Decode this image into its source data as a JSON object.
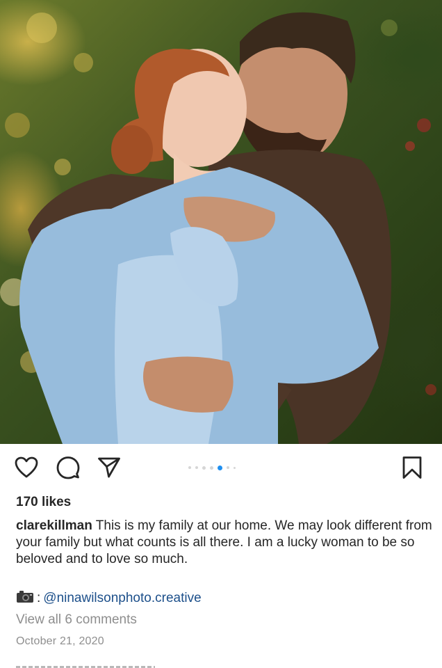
{
  "post": {
    "photo_alt": "Couple embracing outdoors",
    "likes": "170 likes",
    "username": "clarekillman",
    "caption": " This is my family at our home. We may look different from your family but what counts is all there. I am a lucky woman to be so beloved and to love so much.",
    "credit_separator": ":",
    "credit_handle": "@ninawilsonphoto.creative",
    "view_comments": "View all 6 comments",
    "date": "October 21, 2020"
  },
  "carousel": {
    "count": 7,
    "active_index": 4
  },
  "icons": {
    "like": "heart-icon",
    "comment": "comment-bubble-icon",
    "share": "paper-plane-icon",
    "save": "bookmark-icon",
    "camera": "camera-icon"
  },
  "colors": {
    "text": "#262626",
    "muted": "#8e8e8e",
    "link": "#1c4f8a",
    "active_dot": "#1f8ff0",
    "inactive_dot": "#d6d6d6"
  }
}
